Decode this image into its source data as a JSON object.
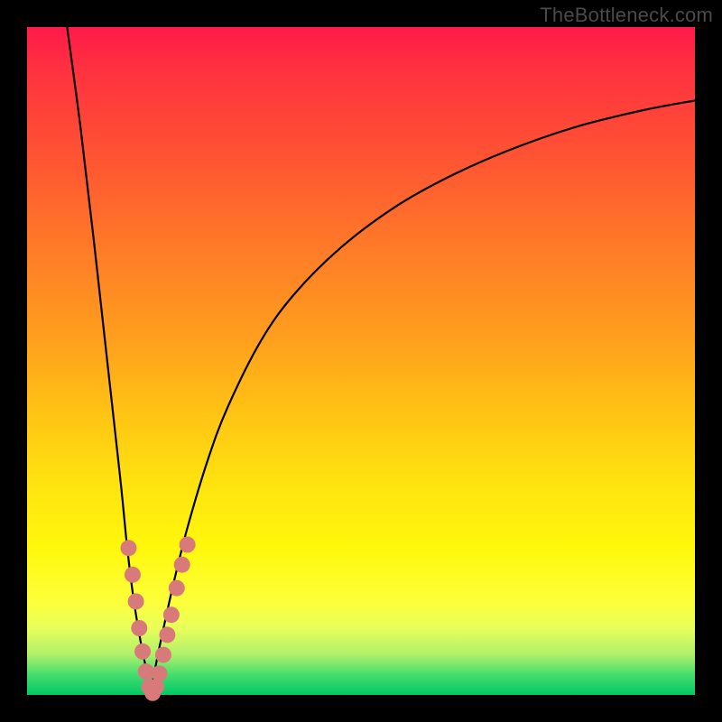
{
  "watermark": "TheBottleneck.com",
  "chart_data": {
    "type": "line",
    "title": "",
    "xlabel": "",
    "ylabel": "",
    "xlim": [
      0,
      100
    ],
    "ylim": [
      0,
      100
    ],
    "grid": false,
    "legend": false,
    "series": [
      {
        "name": "curve-left",
        "x": [
          6,
          8,
          10,
          12,
          14,
          15,
          16,
          17,
          18,
          18.5
        ],
        "y": [
          100,
          85,
          68,
          50,
          32,
          22,
          14,
          8,
          3,
          0
        ]
      },
      {
        "name": "curve-right",
        "x": [
          18.5,
          19,
          20,
          22,
          24,
          27,
          30,
          35,
          40,
          47,
          55,
          63,
          72,
          82,
          92,
          100
        ],
        "y": [
          0,
          3,
          8,
          17,
          25,
          35,
          43,
          53,
          60,
          67,
          73,
          77.5,
          81.5,
          85,
          87.5,
          89
        ]
      }
    ],
    "markers": {
      "name": "dots",
      "color": "#d97a7a",
      "radius_px": 9,
      "points": [
        {
          "x": 15.2,
          "y": 22
        },
        {
          "x": 15.8,
          "y": 18
        },
        {
          "x": 16.3,
          "y": 14
        },
        {
          "x": 16.8,
          "y": 10
        },
        {
          "x": 17.3,
          "y": 6.5
        },
        {
          "x": 17.8,
          "y": 3.5
        },
        {
          "x": 18.3,
          "y": 1.2
        },
        {
          "x": 18.8,
          "y": 0.3
        },
        {
          "x": 19.3,
          "y": 1.2
        },
        {
          "x": 19.8,
          "y": 3.2
        },
        {
          "x": 20.4,
          "y": 6
        },
        {
          "x": 21.0,
          "y": 9
        },
        {
          "x": 21.6,
          "y": 12
        },
        {
          "x": 22.4,
          "y": 16
        },
        {
          "x": 23.2,
          "y": 19.5
        },
        {
          "x": 24.0,
          "y": 22.5
        }
      ]
    }
  }
}
